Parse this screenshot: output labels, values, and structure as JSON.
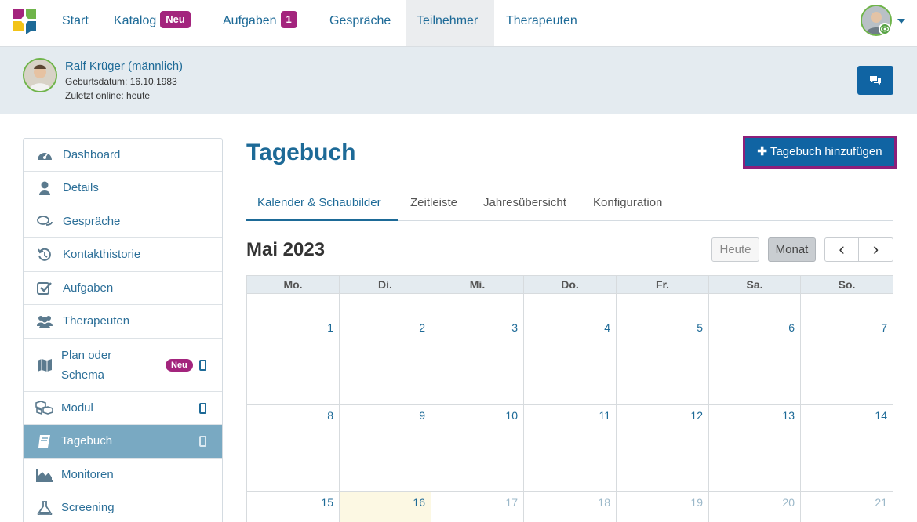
{
  "nav": {
    "items": [
      {
        "label": "Start"
      },
      {
        "label": "Katalog",
        "badge": "Neu"
      },
      {
        "label": "Aufgaben",
        "badge": "1"
      },
      {
        "label": "Gespräche"
      },
      {
        "label": "Teilnehmer",
        "active": true
      },
      {
        "label": "Therapeuten"
      }
    ]
  },
  "patient": {
    "name": "Ralf Krüger (männlich)",
    "birth": "Geburtsdatum: 16.10.1983",
    "online": "Zuletzt online: heute"
  },
  "sidebar": {
    "items": [
      {
        "label": "Dashboard",
        "icon": "dashboard-icon"
      },
      {
        "label": "Details",
        "icon": "user-icon"
      },
      {
        "label": "Gespräche",
        "icon": "chat-bubbles-icon"
      },
      {
        "label": "Kontakthistorie",
        "icon": "history-icon"
      },
      {
        "label": "Aufgaben",
        "icon": "check-square-icon"
      },
      {
        "label": "Therapeuten",
        "icon": "users-icon"
      },
      {
        "label": "Plan oder",
        "label2": "Schema",
        "icon": "map-icon",
        "badge": "Neu",
        "mobile": true
      },
      {
        "label": "Modul",
        "icon": "cubes-icon",
        "mobile": true
      },
      {
        "label": "Tagebuch",
        "icon": "book-icon",
        "mobile": true,
        "active": true
      },
      {
        "label": "Monitoren",
        "icon": "area-chart-icon"
      },
      {
        "label": "Screening",
        "icon": "flask-icon"
      }
    ]
  },
  "main": {
    "title": "Tagebuch",
    "add_label": "Tagebuch hinzufügen",
    "tabs": [
      "Kalender & Schaubilder",
      "Zeitleiste",
      "Jahresübersicht",
      "Konfiguration"
    ]
  },
  "calendar": {
    "month": "Mai 2023",
    "today_label": "Heute",
    "month_label": "Monat",
    "prev_glyph": "‹",
    "next_glyph": "›",
    "weekdays": [
      "Mo.",
      "Di.",
      "Mi.",
      "Do.",
      "Fr.",
      "Sa.",
      "So."
    ],
    "weeks": [
      [
        "",
        "",
        "",
        "",
        "",
        "",
        ""
      ],
      [
        "1",
        "2",
        "3",
        "4",
        "5",
        "6",
        "7"
      ],
      [
        "8",
        "9",
        "10",
        "11",
        "12",
        "13",
        "14"
      ],
      [
        "15",
        "16",
        "17",
        "18",
        "19",
        "20",
        "21"
      ]
    ],
    "today_date": "16"
  },
  "colors": {
    "accent": "#1064a3",
    "badge": "#a3247d",
    "sidebar_active": "#79a9c2"
  }
}
